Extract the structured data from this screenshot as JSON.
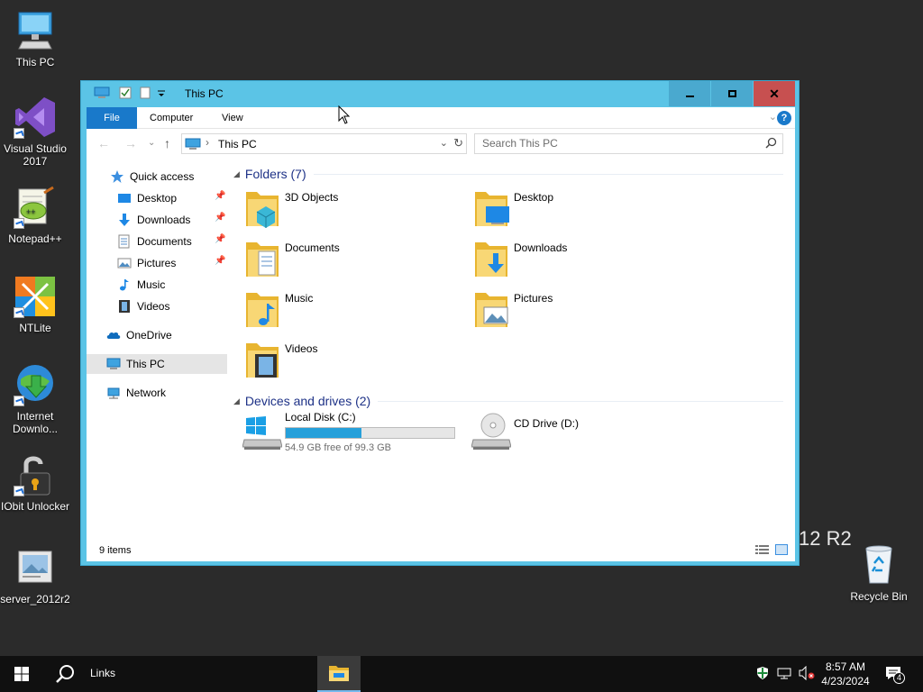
{
  "desktop": {
    "icons": [
      {
        "label": "This PC",
        "icon": "computer-icon"
      },
      {
        "label": "Visual Studio 2017",
        "icon": "visual-studio-icon"
      },
      {
        "label": "Notepad++",
        "icon": "notepad-plus-plus-icon"
      },
      {
        "label": "NTLite",
        "icon": "ntlite-icon"
      },
      {
        "label": "Internet Downlo...",
        "icon": "internet-download-manager-icon"
      },
      {
        "label": "IObit Unlocker",
        "icon": "iobit-unlocker-icon"
      },
      {
        "label": "server_2012r2",
        "icon": "image-file-icon"
      },
      {
        "label": "Recycle Bin",
        "icon": "recycle-bin-icon"
      }
    ],
    "watermark": "12 R2"
  },
  "window": {
    "title": "This PC",
    "ribbon_tabs": [
      "File",
      "Computer",
      "View"
    ],
    "help_label": "?",
    "address": {
      "location": "This PC"
    },
    "search": {
      "placeholder": "Search This PC"
    },
    "nav": {
      "items": [
        {
          "label": "Quick access",
          "icon": "star-icon"
        },
        {
          "label": "Desktop",
          "icon": "desktop-icon",
          "pinned": true
        },
        {
          "label": "Downloads",
          "icon": "download-arrow-icon",
          "pinned": true
        },
        {
          "label": "Documents",
          "icon": "document-icon",
          "pinned": true
        },
        {
          "label": "Pictures",
          "icon": "picture-icon",
          "pinned": true
        },
        {
          "label": "Music",
          "icon": "music-note-icon"
        },
        {
          "label": "Videos",
          "icon": "film-icon"
        },
        {
          "label": "OneDrive",
          "icon": "cloud-icon"
        },
        {
          "label": "This PC",
          "icon": "computer-icon",
          "selected": true
        },
        {
          "label": "Network",
          "icon": "network-icon"
        }
      ]
    },
    "folders_header": "Folders (7)",
    "folders": [
      {
        "name": "3D Objects",
        "icon": "3d-objects-folder-icon"
      },
      {
        "name": "Desktop",
        "icon": "desktop-folder-icon"
      },
      {
        "name": "Documents",
        "icon": "documents-folder-icon"
      },
      {
        "name": "Downloads",
        "icon": "downloads-folder-icon"
      },
      {
        "name": "Music",
        "icon": "music-folder-icon"
      },
      {
        "name": "Pictures",
        "icon": "pictures-folder-icon"
      },
      {
        "name": "Videos",
        "icon": "videos-folder-icon"
      }
    ],
    "devices_header": "Devices and drives (2)",
    "drives": [
      {
        "name": "Local Disk (C:)",
        "free_text": "54.9 GB free of 99.3 GB",
        "used_fraction": 0.447,
        "icon": "windows-drive-icon"
      },
      {
        "name": "CD Drive (D:)",
        "icon": "cd-drive-icon"
      }
    ],
    "status": {
      "item_count": "9 items"
    }
  },
  "taskbar": {
    "links_label": "Links",
    "time": "8:57 AM",
    "date": "4/23/2024",
    "notification_count": "4"
  },
  "colors": {
    "window_frame": "#5bc4e6",
    "accent": "#1979ca",
    "close_button": "#c75050",
    "drive_bar": "#26a0da"
  }
}
